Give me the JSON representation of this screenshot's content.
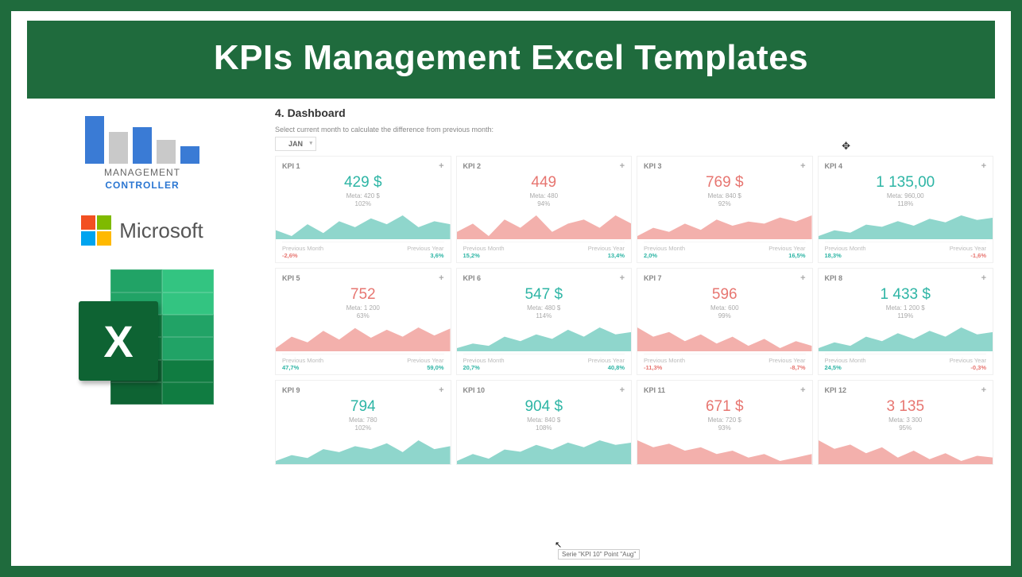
{
  "title": "KPIs Management Excel Templates",
  "left": {
    "mgmt_line1": "MANAGEMENT",
    "mgmt_line2": "CONTROLLER",
    "ms_label": "Microsoft",
    "excel_letter": "X"
  },
  "dashboard": {
    "heading": "4. Dashboard",
    "subtitle": "Select current month to calculate the difference from previous month:",
    "month": "JAN",
    "prev_month_label": "Previous Month",
    "prev_year_label": "Previous Year",
    "tooltip": "Serie \"KPI 10\" Point \"Aug\""
  },
  "kpis": [
    {
      "name": "KPI 1",
      "value": "429 $",
      "color": "teal",
      "meta": "Meta: 420 $",
      "pct": "102%",
      "pm": "-2,6%",
      "pm_cls": "red",
      "py": "3,6%",
      "py_cls": "teal"
    },
    {
      "name": "KPI 2",
      "value": "449",
      "color": "red",
      "meta": "Meta: 480",
      "pct": "94%",
      "pm": "15,2%",
      "pm_cls": "teal",
      "py": "13,4%",
      "py_cls": "teal"
    },
    {
      "name": "KPI 3",
      "value": "769 $",
      "color": "red",
      "meta": "Meta: 840 $",
      "pct": "92%",
      "pm": "2,0%",
      "pm_cls": "teal",
      "py": "16,5%",
      "py_cls": "teal"
    },
    {
      "name": "KPI 4",
      "value": "1 135,00",
      "color": "teal",
      "meta": "Meta: 960,00",
      "pct": "118%",
      "pm": "18,3%",
      "pm_cls": "teal",
      "py": "-1,6%",
      "py_cls": "red"
    },
    {
      "name": "KPI 5",
      "value": "752",
      "color": "red",
      "meta": "Meta: 1 200",
      "pct": "63%",
      "pm": "47,7%",
      "pm_cls": "teal",
      "py": "59,0%",
      "py_cls": "teal"
    },
    {
      "name": "KPI 6",
      "value": "547 $",
      "color": "teal",
      "meta": "Meta: 480 $",
      "pct": "114%",
      "pm": "20,7%",
      "pm_cls": "teal",
      "py": "40,8%",
      "py_cls": "teal"
    },
    {
      "name": "KPI 7",
      "value": "596",
      "color": "red",
      "meta": "Meta: 600",
      "pct": "99%",
      "pm": "-11,3%",
      "pm_cls": "red",
      "py": "-8,7%",
      "py_cls": "red"
    },
    {
      "name": "KPI 8",
      "value": "1 433 $",
      "color": "teal",
      "meta": "Meta: 1 200 $",
      "pct": "119%",
      "pm": "24,5%",
      "pm_cls": "teal",
      "py": "-0,3%",
      "py_cls": "red"
    },
    {
      "name": "KPI 9",
      "value": "794",
      "color": "teal",
      "meta": "Meta: 780",
      "pct": "102%",
      "pm": "",
      "pm_cls": "",
      "py": "",
      "py_cls": ""
    },
    {
      "name": "KPI 10",
      "value": "904 $",
      "color": "teal",
      "meta": "Meta: 840 $",
      "pct": "108%",
      "pm": "",
      "pm_cls": "",
      "py": "",
      "py_cls": ""
    },
    {
      "name": "KPI 11",
      "value": "671 $",
      "color": "red",
      "meta": "Meta: 720 $",
      "pct": "93%",
      "pm": "",
      "pm_cls": "",
      "py": "",
      "py_cls": ""
    },
    {
      "name": "KPI 12",
      "value": "3 135",
      "color": "red",
      "meta": "Meta: 3 300",
      "pct": "95%",
      "pm": "",
      "pm_cls": "",
      "py": "",
      "py_cls": ""
    }
  ],
  "chart_data": {
    "type": "area",
    "note": "12 sparkline area charts, monthly series Jan–Dec (approximate, read from shape)",
    "series": [
      {
        "name": "KPI 1",
        "color": "teal",
        "values": [
          42,
          40,
          44,
          41,
          45,
          43,
          46,
          44,
          47,
          43,
          45,
          44
        ]
      },
      {
        "name": "KPI 2",
        "color": "red",
        "values": [
          44,
          46,
          43,
          47,
          45,
          48,
          44,
          46,
          47,
          45,
          48,
          46
        ]
      },
      {
        "name": "KPI 3",
        "color": "red",
        "values": [
          70,
          74,
          72,
          76,
          73,
          78,
          75,
          77,
          76,
          79,
          77,
          80
        ]
      },
      {
        "name": "KPI 4",
        "color": "teal",
        "values": [
          100,
          105,
          103,
          110,
          108,
          113,
          109,
          115,
          112,
          118,
          114,
          116
        ]
      },
      {
        "name": "KPI 5",
        "color": "red",
        "values": [
          60,
          80,
          70,
          90,
          75,
          95,
          78,
          92,
          80,
          96,
          82,
          94
        ]
      },
      {
        "name": "KPI 6",
        "color": "teal",
        "values": [
          50,
          52,
          51,
          55,
          53,
          56,
          54,
          58,
          55,
          59,
          56,
          57
        ]
      },
      {
        "name": "KPI 7",
        "color": "red",
        "values": [
          62,
          58,
          60,
          56,
          59,
          55,
          58,
          54,
          57,
          53,
          56,
          54
        ]
      },
      {
        "name": "KPI 8",
        "color": "teal",
        "values": [
          130,
          135,
          132,
          140,
          136,
          143,
          138,
          145,
          140,
          148,
          142,
          144
        ]
      },
      {
        "name": "KPI 9",
        "color": "teal",
        "values": [
          76,
          78,
          77,
          80,
          79,
          81,
          80,
          82,
          79,
          83,
          80,
          81
        ]
      },
      {
        "name": "KPI 10",
        "color": "teal",
        "values": [
          85,
          88,
          86,
          90,
          89,
          92,
          90,
          93,
          91,
          94,
          92,
          93
        ]
      },
      {
        "name": "KPI 11",
        "color": "red",
        "values": [
          70,
          68,
          69,
          67,
          68,
          66,
          67,
          65,
          66,
          64,
          65,
          66
        ]
      },
      {
        "name": "KPI 12",
        "color": "red",
        "values": [
          320,
          310,
          315,
          305,
          312,
          300,
          308,
          298,
          305,
          296,
          302,
          300
        ]
      }
    ]
  }
}
